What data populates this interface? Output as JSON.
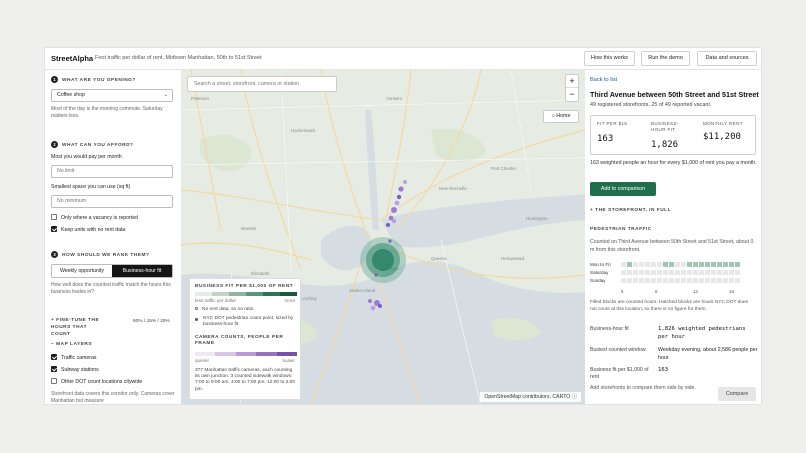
{
  "header": {
    "brand": "StreetAlpha",
    "tagline": "Foot traffic per dollar of rent, Midtown Manhattan, 50th to 51st Street",
    "buttons": [
      "How this works",
      "Run the demo",
      "Data and sources"
    ]
  },
  "sidebar": {
    "step1": {
      "num": "1",
      "title": "WHAT ARE YOU OPENING?",
      "select_value": "Coffee shop",
      "help": "Most of the day is the morning commute. Saturday matters less."
    },
    "step2": {
      "num": "2",
      "title": "WHAT CAN YOU AFFORD?",
      "rent_label": "Most you would pay per month",
      "rent_placeholder": "No limit",
      "space_label": "Smallest space you can use (sq ft)",
      "space_placeholder": "No minimum",
      "checks": [
        {
          "label": "Only where a vacancy is reported",
          "checked": false
        },
        {
          "label": "Keep units with no rent data",
          "checked": true
        }
      ]
    },
    "step3": {
      "num": "3",
      "title": "HOW SHOULD WE RANK THEM?",
      "options": [
        "Weekly opportunity",
        "Business-hour fit"
      ],
      "selected": "Business-hour fit",
      "help": "How well does the counted traffic match the hours this business trades in?"
    },
    "finetune": {
      "label": "FINE-TUNE THE HOURS THAT COUNT",
      "values": "60% / 15% / 25%"
    },
    "layers": {
      "title": "MAP LAYERS",
      "items": [
        {
          "label": "Traffic cameras",
          "checked": true
        },
        {
          "label": "Subway stations",
          "checked": true
        },
        {
          "label": "Other DOT count locations citywide",
          "checked": false
        }
      ],
      "note": "Storefront data covers this corridor only. Cameras cover Manhattan but measure"
    }
  },
  "map": {
    "search_placeholder": "Search a street, storefront, camera or station",
    "zoom_in": "+",
    "zoom_out": "−",
    "home": "Home",
    "attribution": "OpenStreetMap contributors, CARTO",
    "legend": {
      "title": "BUSINESS FIT PER $1,000 OF RENT",
      "low": "less traffic per dollar",
      "high": "more",
      "no_rent": "No rent data, so no ratio",
      "dot_note": "NYC DOT pedestrian count point, sized by business-hour fit",
      "camera_title": "CAMERA COUNTS, PEOPLE PER FRAME",
      "quiet": "quieter",
      "busy": "busier",
      "camera_note": "377 Manhattan traffic cameras, each counting its own junction. 3 counted sidewalk windows: 7:00 to 9:00 am, 4:00 to 7:00 pm, 12:00 to 2:00 pm.",
      "fit_colors": [
        "#e6ece8",
        "#bcd3c5",
        "#8db5a0",
        "#5b957a",
        "#2f7456",
        "#145a3e"
      ],
      "camera_colors": [
        "#eee8f3",
        "#d6c6e4",
        "#b79bd2",
        "#9673bd",
        "#7652a6"
      ]
    }
  },
  "panel": {
    "back": "Back to list",
    "title": "Third Avenue between 50th Street and 51st Street",
    "subtitle": "49 registered storefronts. 25 of 49 reported vacant.",
    "metrics": [
      {
        "label": "FIT PER $1K",
        "value": "163"
      },
      {
        "label": "BUSINESS-HOUR FIT",
        "value": "1,826"
      },
      {
        "label": "MONTHLY RENT",
        "value": "$11,200"
      }
    ],
    "summary": "163 weighted people an hour for every $1,000 of rent you pay a month.",
    "compare_button": "Add to comparison",
    "full_toggle": "THE STOREFRONT, IN FULL",
    "ped_title": "PEDESTRIAN TRAFFIC",
    "ped_text": "Counted on Third Avenue between 50th Street and 51st Street, about 0 m from this storefront.",
    "heatmap": {
      "rows": [
        "Mon to Fri",
        "Saturday",
        "Sunday"
      ],
      "ticks": [
        "8",
        "6",
        "12",
        "18"
      ],
      "filled": [
        [
          0,
          1,
          0,
          0,
          0,
          0,
          0,
          1,
          1,
          0,
          0,
          1,
          1,
          1,
          1,
          1,
          1,
          1,
          1,
          1
        ],
        [
          0,
          0,
          0,
          0,
          0,
          0,
          0,
          0,
          0,
          0,
          0,
          0,
          0,
          0,
          0,
          0,
          0,
          0,
          0,
          0
        ],
        [
          0,
          0,
          0,
          0,
          0,
          0,
          0,
          0,
          0,
          0,
          0,
          0,
          0,
          0,
          0,
          0,
          0,
          0,
          0,
          0
        ]
      ],
      "note": "Filled blocks are counted hours. Hatched blocks are hours NYC DOT does not count at this location, so there is no figure for them."
    },
    "kv": [
      {
        "key": "Business-hour fit",
        "value": "1,826 weighted pedestrians per hour",
        "mono": true
      },
      {
        "key": "Busiest counted window",
        "value": "Weekday evening, about 2,586 people per hour",
        "mono": false
      },
      {
        "key": "Business fit per $1,000 of rent",
        "value": "163",
        "mono": true
      }
    ],
    "compare_text": "Add storefronts to compare them side by side.",
    "compare_action": "Compare"
  }
}
